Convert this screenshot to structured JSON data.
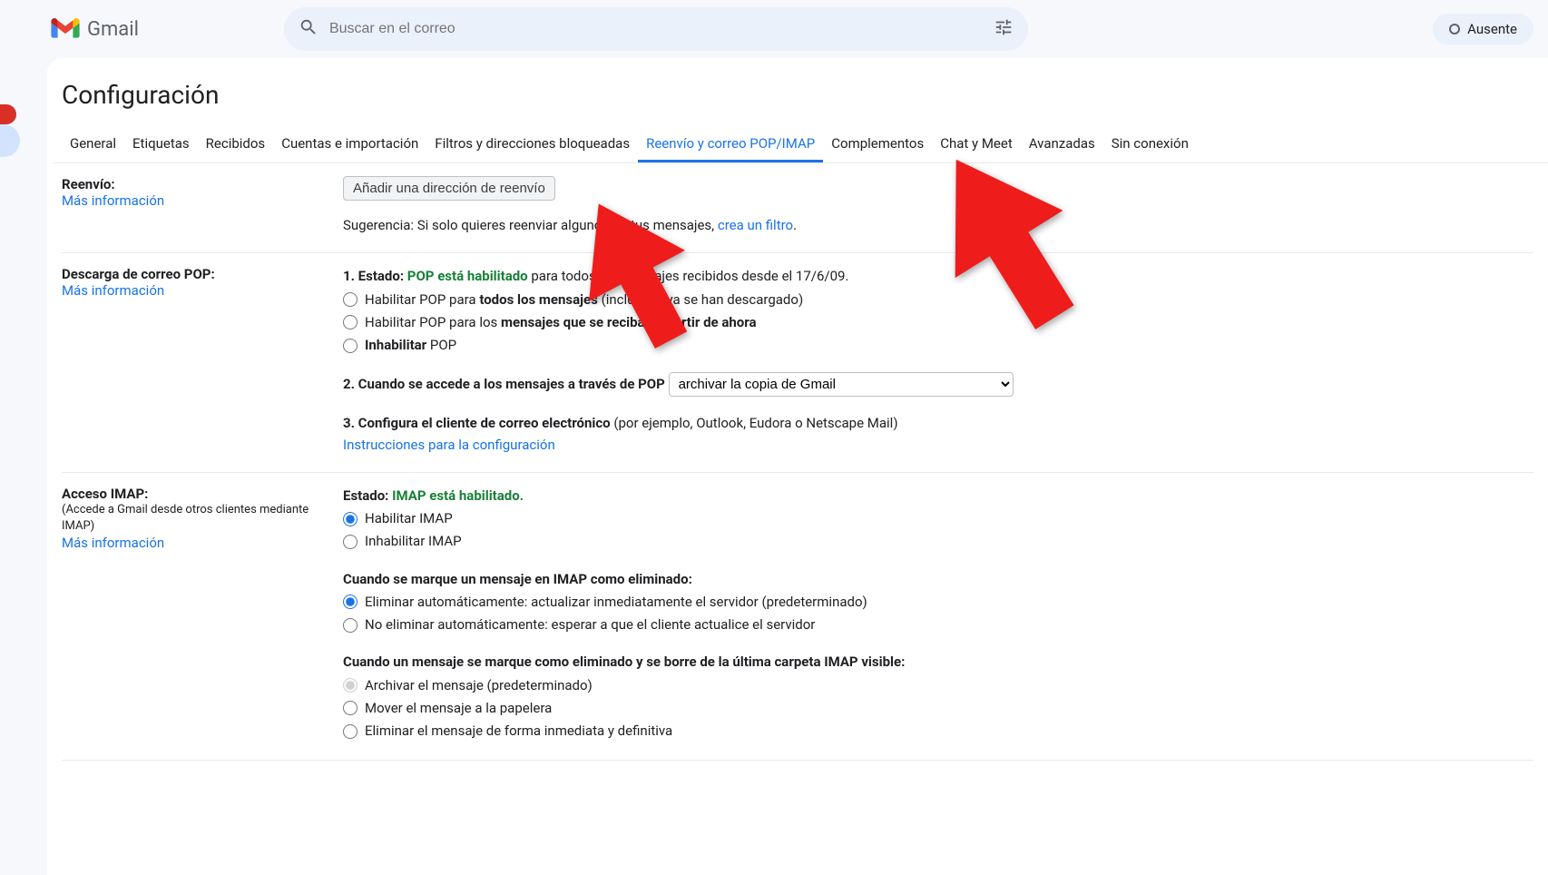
{
  "app": {
    "name": "Gmail",
    "search_placeholder": "Buscar en el correo",
    "status": "Ausente"
  },
  "page": {
    "title": "Configuración"
  },
  "tabs": [
    {
      "label": "General",
      "active": false
    },
    {
      "label": "Etiquetas",
      "active": false
    },
    {
      "label": "Recibidos",
      "active": false
    },
    {
      "label": "Cuentas e importación",
      "active": false
    },
    {
      "label": "Filtros y direcciones bloqueadas",
      "active": false
    },
    {
      "label": "Reenvío y correo POP/IMAP",
      "active": true
    },
    {
      "label": "Complementos",
      "active": false
    },
    {
      "label": "Chat y Meet",
      "active": false
    },
    {
      "label": "Avanzadas",
      "active": false
    },
    {
      "label": "Sin conexión",
      "active": false
    }
  ],
  "forwarding": {
    "title": "Reenvío:",
    "more_info": "Más información",
    "add_button": "Añadir una dirección de reenvío",
    "tip_prefix": "Sugerencia: Si solo quieres reenviar algunos de tus mensajes, ",
    "tip_link": "crea un filtro",
    "tip_suffix": "."
  },
  "pop": {
    "title": "Descarga de correo POP:",
    "more_info": "Más información",
    "status_label": "1. Estado: ",
    "status_enabled": "POP está habilitado",
    "status_tail": " para todos los mensajes recibidos desde el 17/6/09.",
    "opt_all_prefix": "Habilitar POP para ",
    "opt_all_bold": "todos los mensajes",
    "opt_all_suffix": " (incluso si ya se han descargado)",
    "opt_now_prefix": "Habilitar POP para los ",
    "opt_now_bold": "mensajes que se reciban a partir de ahora",
    "opt_disable_bold": "Inhabilitar",
    "opt_disable_tail": " POP",
    "access_label": "2. Cuando se accede a los mensajes a través de POP ",
    "access_select": "archivar la copia de Gmail",
    "configure_label": "3. Configura el cliente de correo electrónico",
    "configure_example": " (por ejemplo, Outlook, Eudora o Netscape Mail)",
    "configure_link": "Instrucciones para la configuración"
  },
  "imap": {
    "title": "Acceso IMAP:",
    "subtitle": "(Accede a Gmail desde otros clientes mediante IMAP)",
    "more_info": "Más información",
    "status_label": "Estado: ",
    "status_enabled": "IMAP está habilitado.",
    "opt_enable": "Habilitar IMAP",
    "opt_disable": "Inhabilitar IMAP",
    "deleted_header": "Cuando se marque un mensaje en IMAP como eliminado:",
    "del_opt1": "Eliminar automáticamente: actualizar inmediatamente el servidor (predeterminado)",
    "del_opt2": "No eliminar automáticamente: esperar a que el cliente actualice el servidor",
    "lastfolder_header": "Cuando un mensaje se marque como eliminado y se borre de la última carpeta IMAP visible:",
    "lf_opt1": "Archivar el mensaje (predeterminado)",
    "lf_opt2": "Mover el mensaje a la papelera",
    "lf_opt3": "Eliminar el mensaje de forma inmediata y definitiva"
  }
}
